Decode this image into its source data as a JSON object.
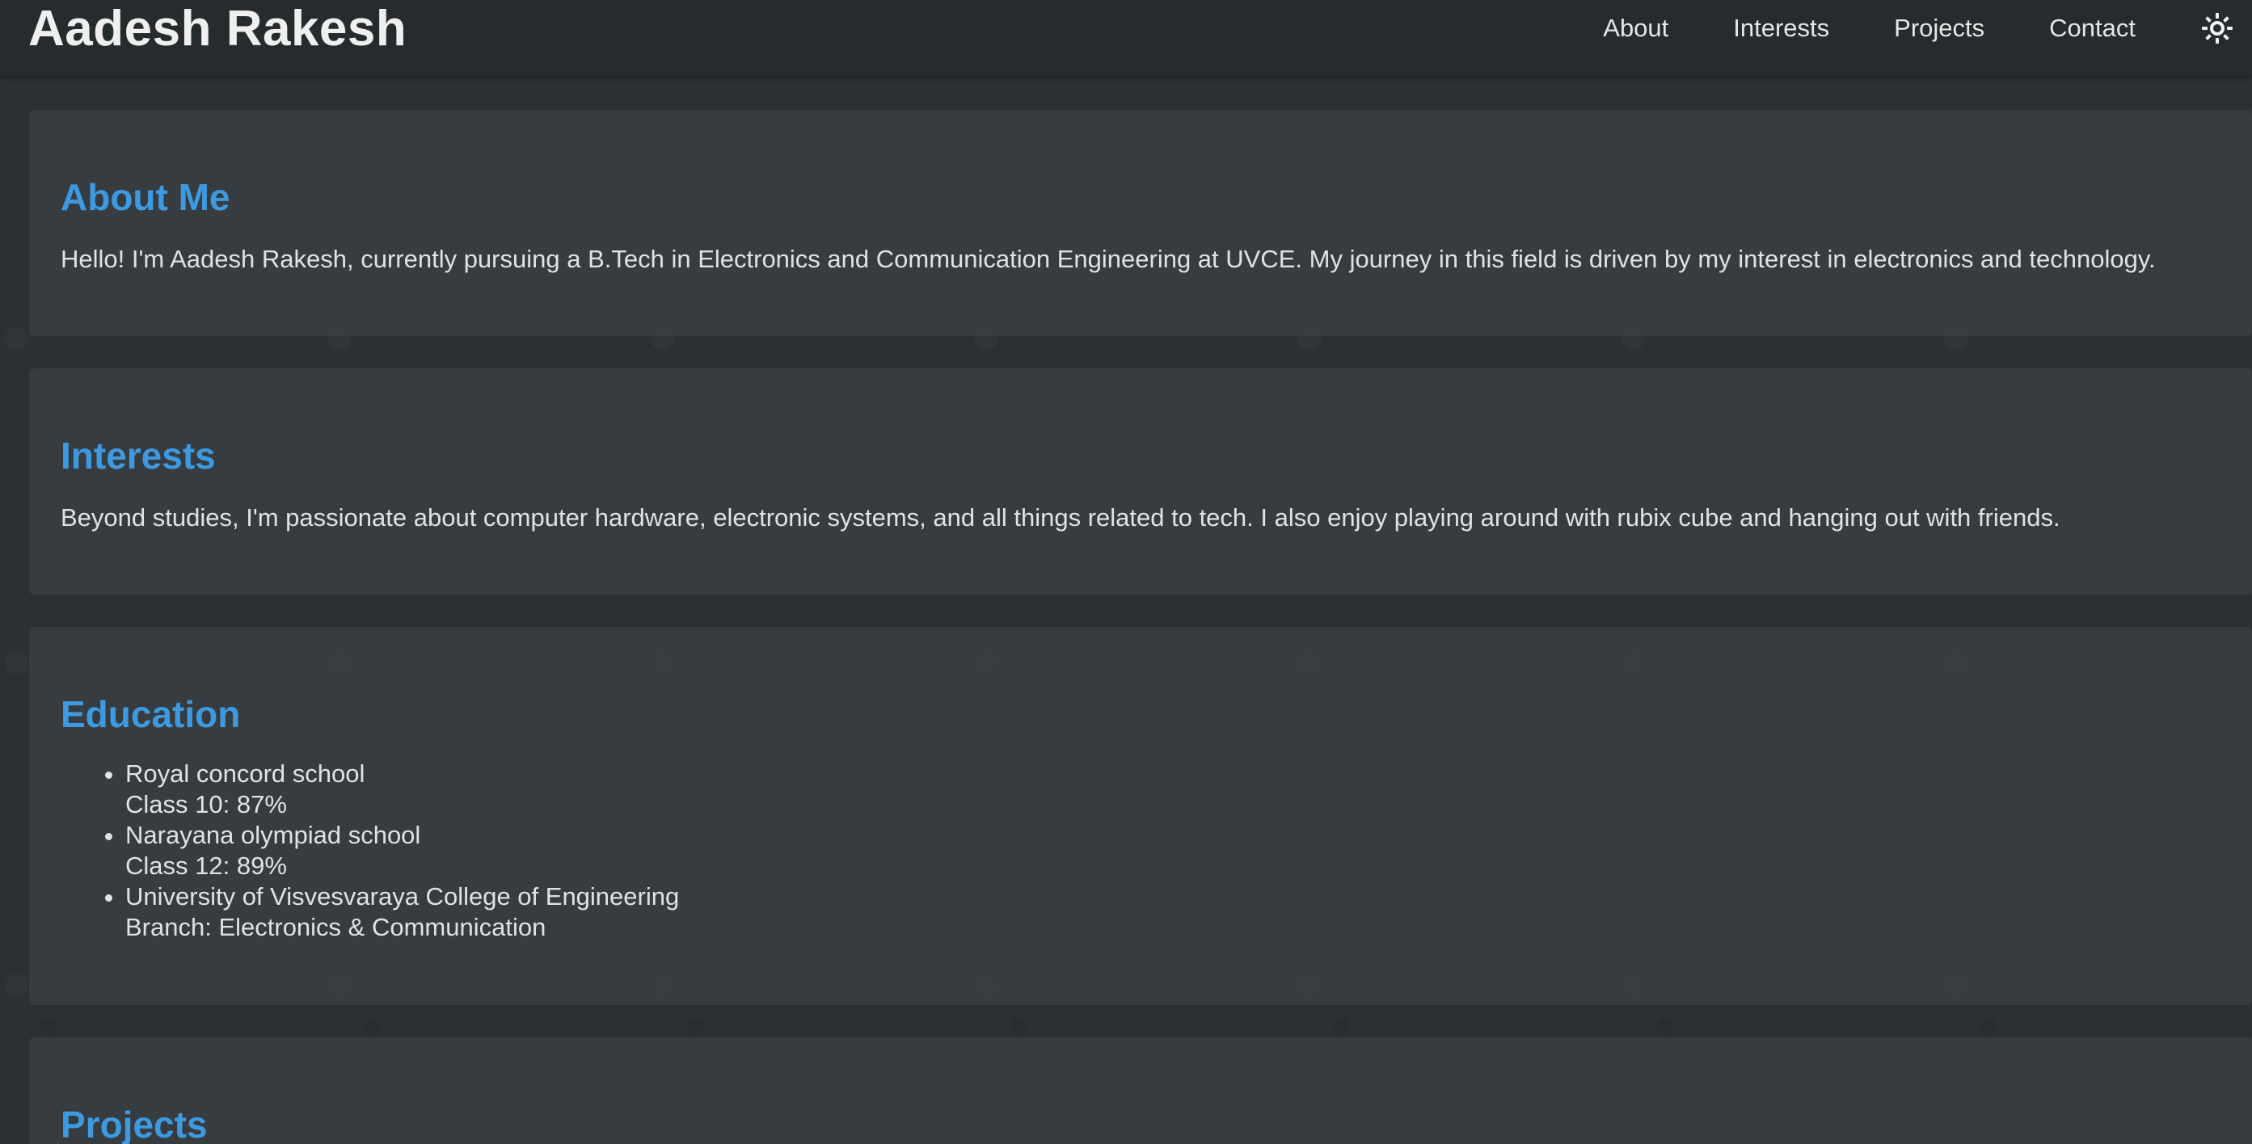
{
  "header": {
    "title": "Aadesh Rakesh",
    "nav": [
      {
        "label": "About"
      },
      {
        "label": "Interests"
      },
      {
        "label": "Projects"
      },
      {
        "label": "Contact"
      }
    ],
    "theme_toggle_icon": "sun-icon"
  },
  "sections": {
    "about": {
      "title": "About Me",
      "text": "Hello! I'm Aadesh Rakesh, currently pursuing a B.Tech in Electronics and Communication Engineering at UVCE. My journey in this field is driven by my interest in electronics and technology."
    },
    "interests": {
      "title": "Interests",
      "text": "Beyond studies, I'm passionate about computer hardware, electronic systems, and all things related to tech. I also enjoy playing around with rubix cube and hanging out with friends."
    },
    "education": {
      "title": "Education",
      "items": [
        {
          "name": "Royal concord school",
          "detail": "Class 10: 87%"
        },
        {
          "name": "Narayana olympiad school",
          "detail": "Class 12: 89%"
        },
        {
          "name": "University of Visvesvaraya College of Engineering",
          "detail": "Branch: Electronics & Communication"
        }
      ]
    },
    "projects": {
      "title": "Projects"
    }
  },
  "colors": {
    "accent": "#3d9ae0",
    "background": "#2b3033",
    "navbar": "#262b2e",
    "card": "#394042"
  }
}
